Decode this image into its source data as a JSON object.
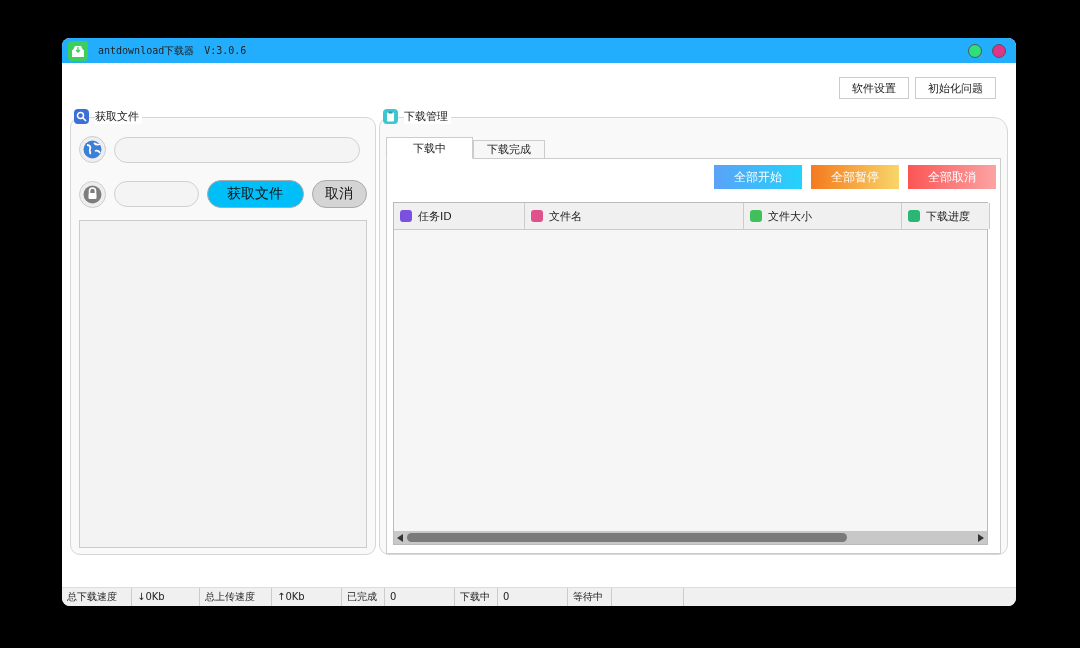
{
  "window": {
    "title": "antdownload下载器",
    "version": "V:3.0.6"
  },
  "header_buttons": [
    "软件设置",
    "初始化问题"
  ],
  "fetch_panel": {
    "title": "获取文件",
    "fetch_button": "获取文件",
    "cancel_button": "取消"
  },
  "download_panel": {
    "title": "下载管理",
    "tabs": [
      {
        "label": "下载中",
        "selected": true
      },
      {
        "label": "下载完成",
        "selected": false
      }
    ],
    "actions": [
      {
        "label": "全部开始",
        "kind": "start"
      },
      {
        "label": "全部暂停",
        "kind": "pause"
      },
      {
        "label": "全部取消",
        "kind": "cancel"
      }
    ],
    "columns": [
      {
        "label": "任务ID",
        "color": "#7b4fe0"
      },
      {
        "label": "文件名",
        "color": "#e0508a"
      },
      {
        "label": "文件大小",
        "color": "#3fc05a"
      },
      {
        "label": "下载进度",
        "color": "#2bb673"
      }
    ]
  },
  "status_bar": [
    "总下载速度",
    "↓0Kb",
    "总上传速度",
    "↑0Kb",
    "已完成",
    "0",
    "下载中",
    "0",
    "等待中"
  ]
}
